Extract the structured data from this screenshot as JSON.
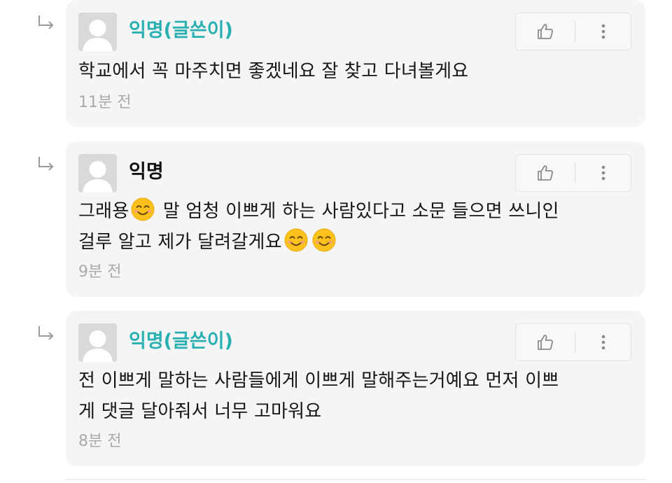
{
  "comments": [
    {
      "author": "익명(글쓴이)",
      "is_op": true,
      "lines": [
        "학교에서 꼭 마주치면 좋겠네요 잘 찾고 다녀볼게요"
      ],
      "time": "11분 전"
    },
    {
      "author": "익명",
      "is_op": false,
      "line1_before": "그래용",
      "line1_after": " 말 엄청 이쁘게 하는 사람있다고 소문 들으면 쓰니인",
      "line2": "걸루 알고 제가 달려갈게요",
      "time": "9분 전"
    },
    {
      "author": "익명(글쓴이)",
      "is_op": true,
      "lines": [
        "전 이쁘게 말하는 사람들에게 이쁘게 말해주는거예요 먼저 이쁘",
        "게 댓글 달아줘서 너무 고마워요"
      ],
      "time": "8분 전"
    }
  ],
  "icons": {
    "reply": "reply-arrow-icon",
    "like": "thumbs-up-icon",
    "more": "more-vertical-icon",
    "avatar": "default-avatar-icon",
    "emoji": "smiling-face-emoji"
  },
  "colors": {
    "op_name": "#2ab0b0",
    "card_bg": "#f5f5f6",
    "time_text": "#a9a9ab"
  }
}
